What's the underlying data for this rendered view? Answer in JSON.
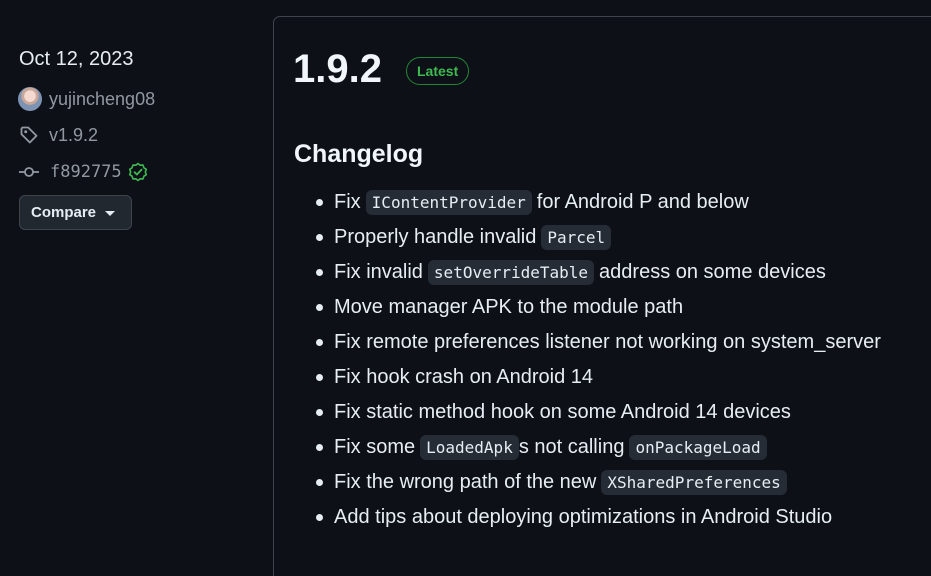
{
  "release": {
    "date": "Oct 12, 2023",
    "author": "yujincheng08",
    "tag": "v1.9.2",
    "commit": "f892775",
    "compare_label": "Compare",
    "version": "1.9.2",
    "badge": "Latest",
    "changelog_heading": "Changelog"
  },
  "changelog": [
    {
      "before": "Fix",
      "code": "IContentProvider",
      "after": "for Android P and below"
    },
    {
      "before": "Properly handle invalid",
      "code": "Parcel"
    },
    {
      "before": "Fix invalid",
      "code": "setOverrideTable",
      "after": "address on some devices"
    },
    {
      "text": "Move manager APK to the module path"
    },
    {
      "text": "Fix remote preferences listener not working on system_server"
    },
    {
      "text": "Fix hook crash on Android 14"
    },
    {
      "text": "Fix static method hook on some Android 14 devices"
    },
    {
      "before": "Fix some",
      "code": "LoadedApk",
      "after": "s not calling",
      "code2": "onPackageLoad"
    },
    {
      "before": "Fix the wrong path of the new",
      "code": "XSharedPreferences"
    },
    {
      "text": "Add tips about deploying optimizations in Android Studio"
    }
  ],
  "colors": {
    "background": "#0d1117",
    "text": "#e6edf3",
    "muted": "#9198a1",
    "border": "#3d444d",
    "success": "#3fb950"
  },
  "icons": {
    "tag": "tag-icon",
    "commit": "git-commit-icon",
    "verified": "verified-check-icon",
    "dropdown": "triangle-down-icon"
  }
}
